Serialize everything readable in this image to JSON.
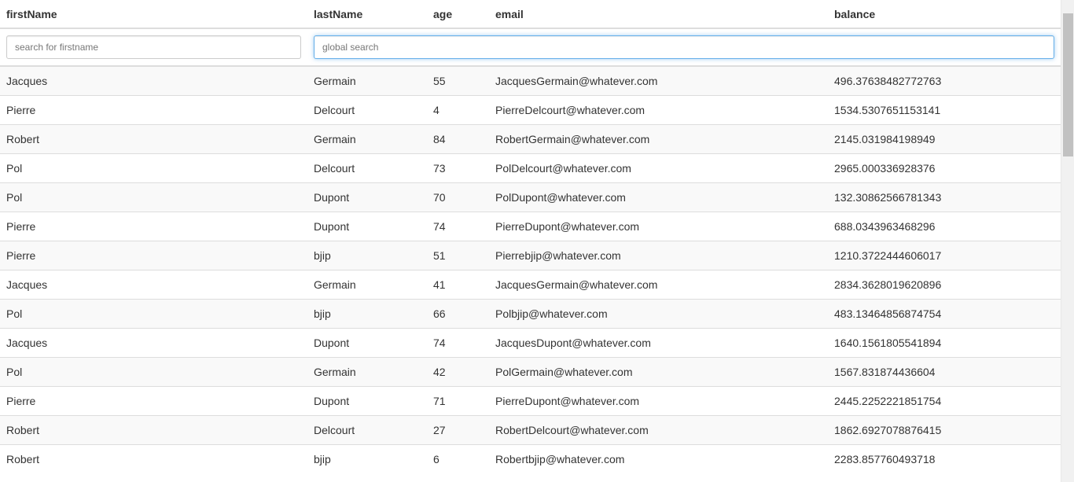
{
  "table": {
    "columns": [
      "firstName",
      "lastName",
      "age",
      "email",
      "balance"
    ],
    "filters": {
      "firstname_placeholder": "search for firstname",
      "firstname_value": "",
      "global_placeholder": "global search",
      "global_value": ""
    },
    "rows": [
      [
        "Jacques",
        "Germain",
        "55",
        "JacquesGermain@whatever.com",
        "496.37638482772763"
      ],
      [
        "Pierre",
        "Delcourt",
        "4",
        "PierreDelcourt@whatever.com",
        "1534.5307651153141"
      ],
      [
        "Robert",
        "Germain",
        "84",
        "RobertGermain@whatever.com",
        "2145.031984198949"
      ],
      [
        "Pol",
        "Delcourt",
        "73",
        "PolDelcourt@whatever.com",
        "2965.000336928376"
      ],
      [
        "Pol",
        "Dupont",
        "70",
        "PolDupont@whatever.com",
        "132.30862566781343"
      ],
      [
        "Pierre",
        "Dupont",
        "74",
        "PierreDupont@whatever.com",
        "688.0343963468296"
      ],
      [
        "Pierre",
        "bjip",
        "51",
        "Pierrebjip@whatever.com",
        "1210.3722444606017"
      ],
      [
        "Jacques",
        "Germain",
        "41",
        "JacquesGermain@whatever.com",
        "2834.3628019620896"
      ],
      [
        "Pol",
        "bjip",
        "66",
        "Polbjip@whatever.com",
        "483.13464856874754"
      ],
      [
        "Jacques",
        "Dupont",
        "74",
        "JacquesDupont@whatever.com",
        "1640.1561805541894"
      ],
      [
        "Pol",
        "Germain",
        "42",
        "PolGermain@whatever.com",
        "1567.831874436604"
      ],
      [
        "Pierre",
        "Dupont",
        "71",
        "PierreDupont@whatever.com",
        "2445.2252221851754"
      ],
      [
        "Robert",
        "Delcourt",
        "27",
        "RobertDelcourt@whatever.com",
        "1862.6927078876415"
      ],
      [
        "Robert",
        "bjip",
        "6",
        "Robertbjip@whatever.com",
        "2283.857760493718"
      ]
    ]
  },
  "colors": {
    "focus_border": "#66afe9",
    "stripe": "#f9f9f9",
    "border": "#dddddd"
  }
}
